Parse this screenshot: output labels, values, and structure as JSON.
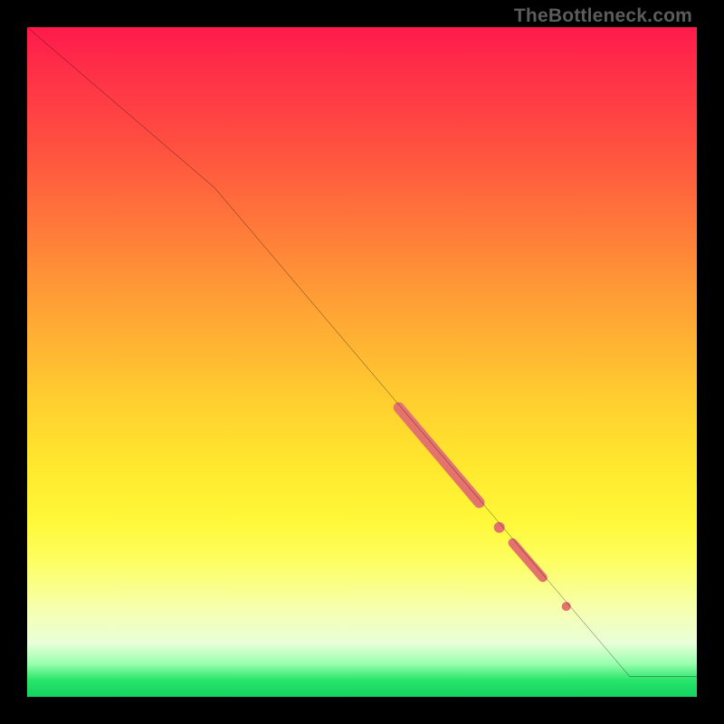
{
  "attribution": "TheBottleneck.com",
  "chart_data": {
    "type": "line",
    "title": "",
    "xlabel": "",
    "ylabel": "",
    "xlim": [
      0,
      100
    ],
    "ylim": [
      0,
      100
    ],
    "grid": false,
    "series": [
      {
        "name": "bottleneck-curve",
        "x": [
          0,
          28,
          90,
          100
        ],
        "y": [
          100,
          76,
          3,
          3
        ],
        "stroke": "#000000",
        "width": 2.5
      }
    ],
    "markers": [
      {
        "name": "highlight-segment-1",
        "shape": "capsule",
        "x": [
          55.5,
          67.5
        ],
        "y": [
          43.2,
          29.0
        ],
        "stroke": "#e5736d",
        "width": 12
      },
      {
        "name": "highlight-dot-1",
        "shape": "dot",
        "x": 70.5,
        "y": 25.3,
        "fill": "#e5736d",
        "r": 6
      },
      {
        "name": "highlight-segment-2",
        "shape": "capsule",
        "x": [
          72.5,
          77.0
        ],
        "y": [
          23.0,
          17.8
        ],
        "stroke": "#e5736d",
        "width": 10
      },
      {
        "name": "highlight-dot-2",
        "shape": "dot",
        "x": 80.5,
        "y": 13.5,
        "fill": "#e5736d",
        "r": 5
      }
    ],
    "background_gradient": {
      "direction": "top-to-bottom",
      "stops": [
        {
          "pos": 0.0,
          "color": "#ff1a4b"
        },
        {
          "pos": 0.3,
          "color": "#ff7a3a"
        },
        {
          "pos": 0.56,
          "color": "#ffcf2f"
        },
        {
          "pos": 0.8,
          "color": "#fdff63"
        },
        {
          "pos": 0.92,
          "color": "#e8ffd8"
        },
        {
          "pos": 1.0,
          "color": "#16d160"
        }
      ]
    }
  }
}
